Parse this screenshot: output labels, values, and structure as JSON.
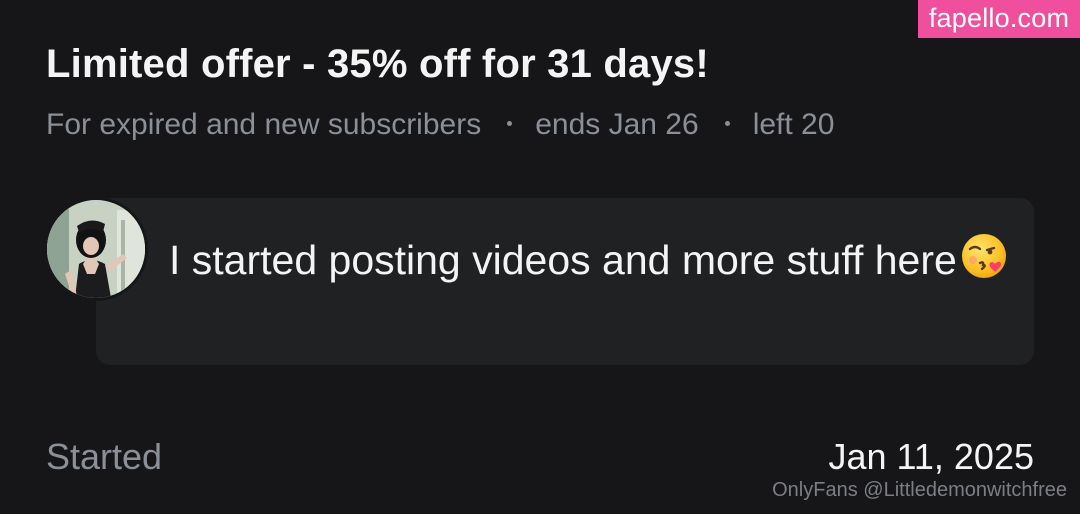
{
  "watermark": {
    "text": "fapello.com"
  },
  "offer": {
    "title": "Limited offer - 35% off for 31 days!",
    "audience": "For expired and new subscribers",
    "ends": "ends Jan 26",
    "left": "left 20"
  },
  "message": {
    "text": "I started posting videos and more stuff here",
    "emoji": "face-throwing-a-kiss-icon"
  },
  "subscription": {
    "started_label": "Started",
    "started_date": "Jan 11, 2025"
  },
  "source": {
    "text": "OnlyFans @Littledemonwitchfree"
  },
  "colors": {
    "background": "#161618",
    "bubble": "#1f2123",
    "muted_text": "#8a8f98",
    "watermark_bg": "#ef4f9d"
  }
}
